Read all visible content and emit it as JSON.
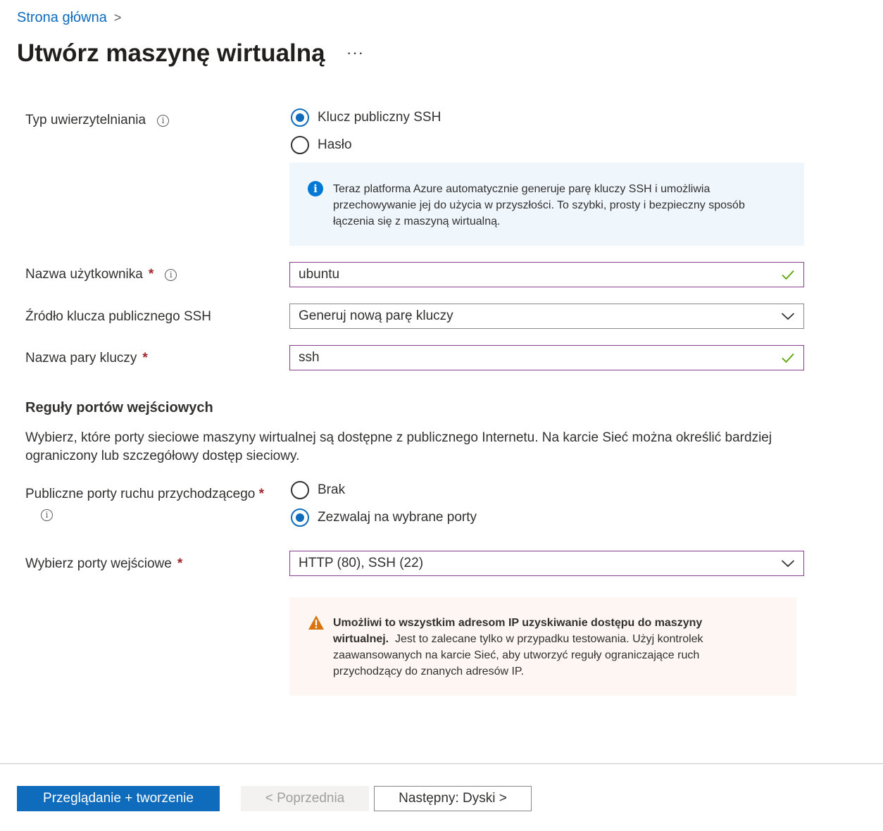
{
  "breadcrumb": {
    "home": "Strona główna",
    "separator": ">"
  },
  "page": {
    "title": "Utwórz maszynę wirtualną",
    "more": "···"
  },
  "auth": {
    "label": "Typ uwierzytelniania",
    "options": [
      {
        "label": "Klucz publiczny SSH",
        "checked": true
      },
      {
        "label": "Hasło",
        "checked": false
      }
    ],
    "info": "Teraz platforma Azure automatycznie generuje parę kluczy SSH i umożliwia przechowywanie jej do użycia w przyszłości. To szybki, prosty i bezpieczny sposób łączenia się z maszyną wirtualną."
  },
  "username": {
    "label": "Nazwa użytkownika",
    "required": "*",
    "value": "ubuntu"
  },
  "ssh_source": {
    "label": "Źródło klucza publicznego SSH",
    "value": "Generuj nową parę kluczy"
  },
  "key_pair": {
    "label": "Nazwa pary kluczy",
    "required": "*",
    "value": "ssh"
  },
  "inbound": {
    "section_title": "Reguły portów wejściowych",
    "description": "Wybierz, które porty sieciowe maszyny wirtualnej są dostępne z publicznego Internetu. Na karcie Sieć można określić bardziej ograniczony lub szczegółowy dostęp sieciowy.",
    "public_ports_label": "Publiczne porty ruchu przychodzącego",
    "required": "*",
    "options": [
      {
        "label": "Brak",
        "checked": false
      },
      {
        "label": "Zezwalaj na wybrane porty",
        "checked": true
      }
    ],
    "select_label": "Wybierz porty wejściowe",
    "select_value": "HTTP (80), SSH (22)",
    "warning_bold": "Umożliwi to wszystkim adresom IP uzyskiwanie dostępu do maszyny wirtualnej.",
    "warning_text": "Jest to zalecane tylko w przypadku testowania.  Użyj kontrolek zaawansowanych na karcie Sieć, aby utworzyć reguły ograniczające ruch przychodzący do znanych adresów IP."
  },
  "footer": {
    "review_create": "Przeglądanie + tworzenie",
    "previous": "< Poprzednia",
    "next": "Następny: Dyski >"
  },
  "colors": {
    "accent": "#0f6cbd",
    "field_border_focus": "#8a3c8f",
    "valid_check": "#57a300",
    "required": "#a4262c",
    "info_bg": "#eff6fc",
    "warning_bg": "#fdf6f3",
    "warning_icon": "#d9730d"
  }
}
